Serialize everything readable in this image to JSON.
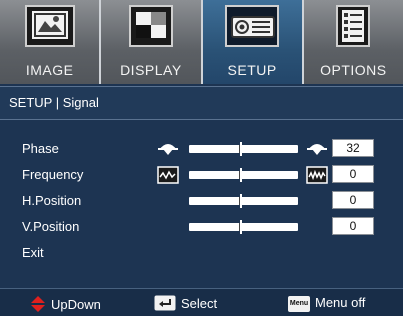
{
  "tabs": [
    {
      "label": "IMAGE",
      "icon": "image-icon",
      "active": false
    },
    {
      "label": "DISPLAY",
      "icon": "display-icon",
      "active": false
    },
    {
      "label": "SETUP",
      "icon": "projector-icon",
      "active": true
    },
    {
      "label": "OPTIONS",
      "icon": "options-icon",
      "active": false
    }
  ],
  "header": {
    "title": "SETUP | Signal"
  },
  "rows": [
    {
      "label": "Phase",
      "value": "32",
      "level": 0.47
    },
    {
      "label": "Frequency",
      "value": "0",
      "level": 0.47
    },
    {
      "label": "H.Position",
      "value": "0",
      "level": 0.47
    },
    {
      "label": "V.Position",
      "value": "0",
      "level": 0.47
    },
    {
      "label": "Exit"
    }
  ],
  "footer": {
    "updown": "UpDown",
    "select": "Select",
    "menu_key": "Menu",
    "menu_off": "Menu off"
  },
  "colors": {
    "active_tab": "#2a5276",
    "tab": "#5c6065",
    "background": "#1d3452",
    "arrow": "#e0201e"
  }
}
